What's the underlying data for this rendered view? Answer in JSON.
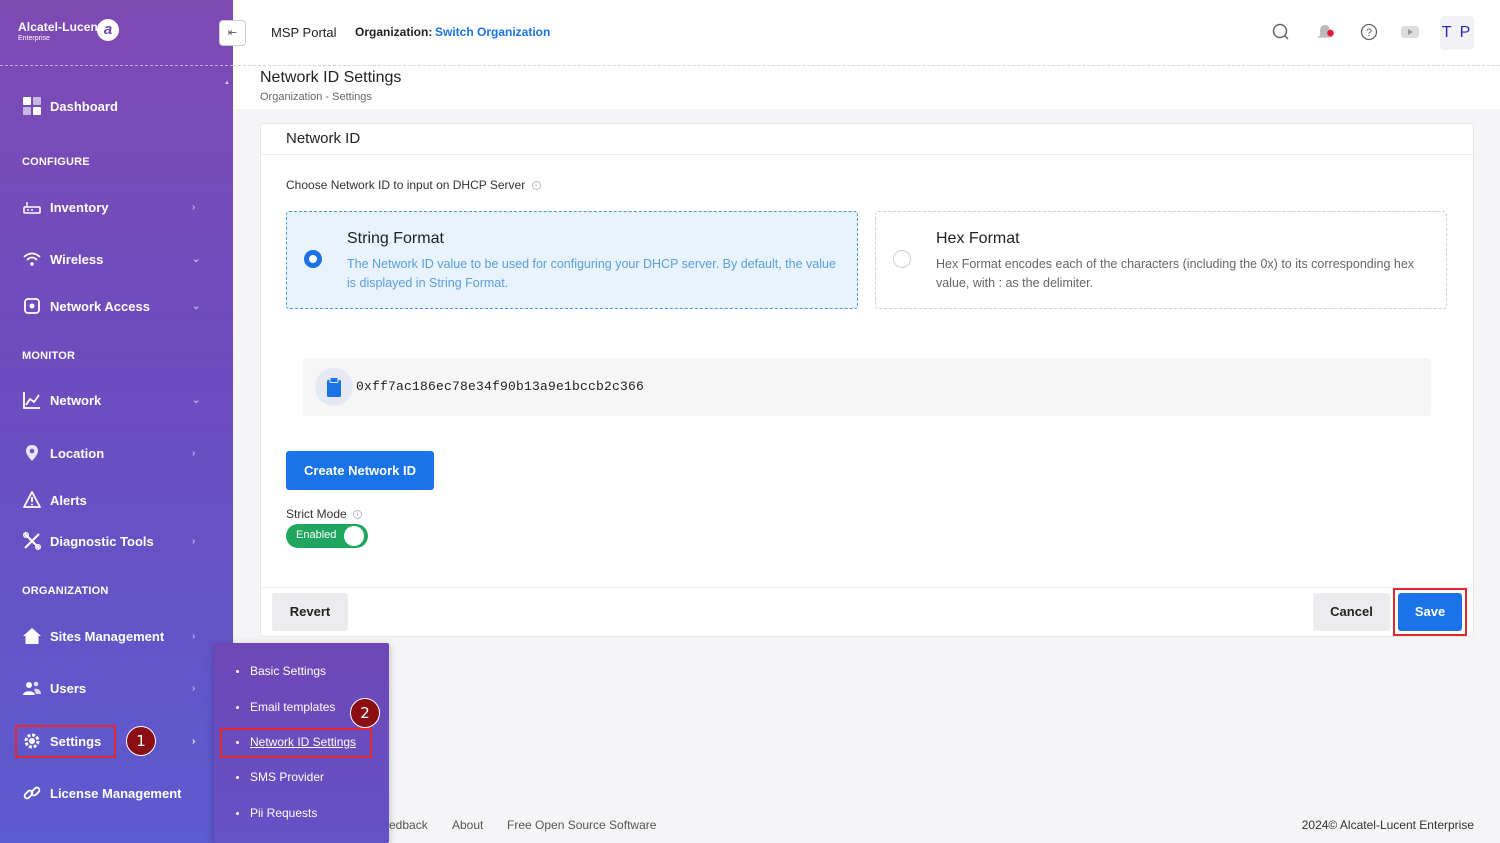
{
  "brand": {
    "name": "Alcatel-Lucent",
    "sub": "Enterprise",
    "logo_glyph": "a"
  },
  "sidebar": {
    "dashboard": "Dashboard",
    "sections": {
      "configure": "CONFIGURE",
      "monitor": "MONITOR",
      "organization": "ORGANIZATION"
    },
    "items": {
      "inventory": "Inventory",
      "wireless": "Wireless",
      "network_access": "Network Access",
      "network": "Network",
      "location": "Location",
      "alerts": "Alerts",
      "diagnostic_tools": "Diagnostic Tools",
      "sites_management": "Sites Management",
      "users": "Users",
      "settings": "Settings",
      "license_management": "License Management"
    },
    "chevron_right": "›",
    "chevron_down": "⌄"
  },
  "flyout": {
    "items": [
      "Basic Settings",
      "Email templates",
      "Network ID Settings",
      "SMS Provider",
      "Pii Requests"
    ],
    "active_index": 2
  },
  "badges": {
    "one": "1",
    "two": "2"
  },
  "header": {
    "collapse_glyph": "⇤",
    "app_name": "MSP Portal",
    "org_label": "Organization:",
    "org_link": "Switch Organization",
    "avatar": "T P",
    "icons": [
      "search-icon",
      "notification-bell-icon",
      "help-icon",
      "video-icon"
    ]
  },
  "page": {
    "title": "Network ID Settings",
    "breadcrumb": "Organization  -  Settings"
  },
  "card": {
    "title": "Network ID",
    "choose_label": "Choose Network ID to input on DHCP Server",
    "info_glyph": "i",
    "options": [
      {
        "title": "String Format",
        "description": "The Network ID value to be used for configuring your DHCP server. By default, the value is displayed in String Format.",
        "selected": true
      },
      {
        "title": "Hex Format",
        "description": "Hex Format encodes each of the characters (including the 0x) to its corresponding hex value, with : as the delimiter.",
        "selected": false
      }
    ],
    "network_id_value": "0xff7ac186ec78e34f90b13a9e1bccb2c366",
    "create_button": "Create Network ID",
    "strict_mode_label": "Strict Mode",
    "strict_mode_state": "Enabled",
    "revert_button": "Revert",
    "cancel_button": "Cancel",
    "save_button": "Save"
  },
  "footer": {
    "links": [
      "edback",
      "About",
      "Free Open Source Software"
    ],
    "copyright": "2024© Alcatel-Lucent Enterprise"
  },
  "colors": {
    "sidebar_top": "#7e4ab4",
    "sidebar_bottom": "#5c5bd0",
    "accent": "#1a73e8",
    "toggle_on": "#20a65e",
    "highlight": "#e0282e",
    "badge": "#8b0e14"
  }
}
